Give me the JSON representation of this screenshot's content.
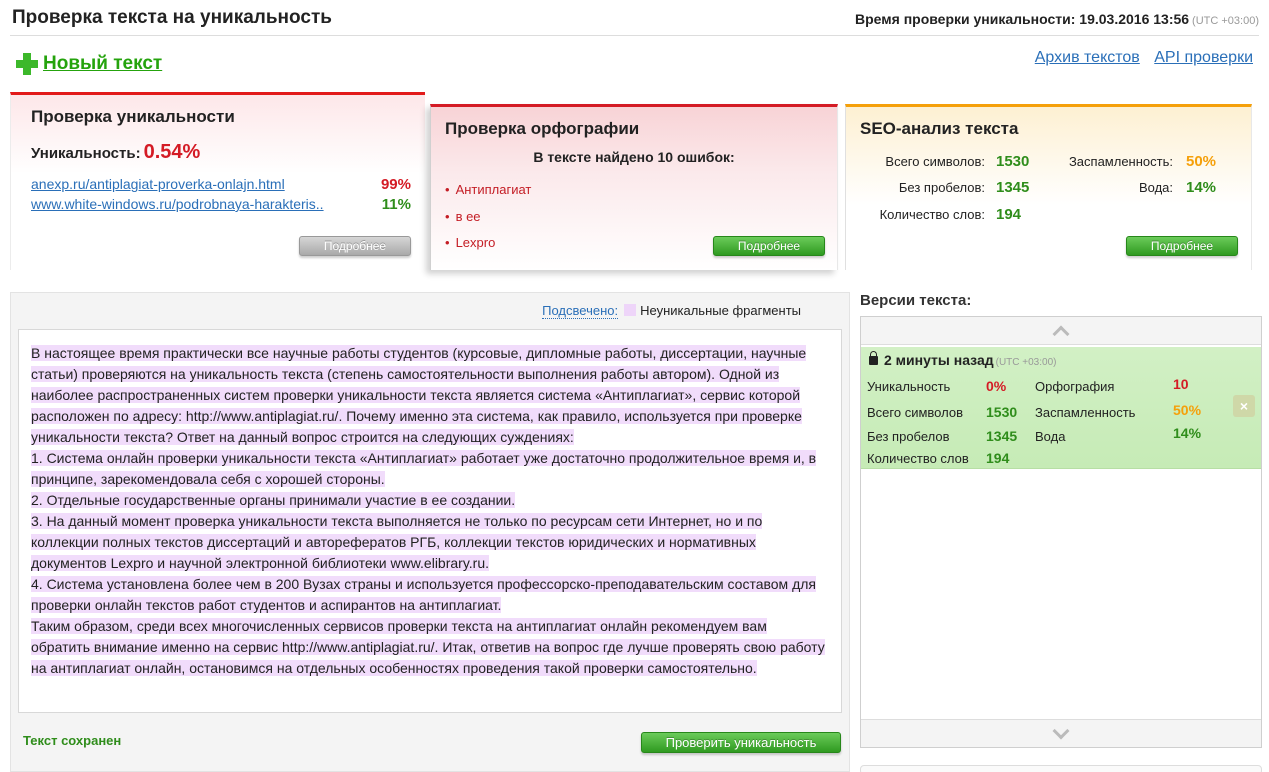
{
  "header": {
    "title": "Проверка текста на уникальность",
    "check_time_label": "Время проверки уникальности: 19.03.2016 13:56",
    "check_time_tz": "(UTC +03:00)"
  },
  "toolbar": {
    "new_text": "Новый текст",
    "links": [
      "Архив текстов",
      "API проверки"
    ]
  },
  "uniqueness_card": {
    "title": "Проверка уникальности",
    "label": "Уникальность:",
    "value": "0.54%",
    "sources": [
      {
        "url": "anexp.ru/antiplagiat-proverka-onlajn.html",
        "percent": "99%"
      },
      {
        "url": "www.white-windows.ru/podrobnaya-harakteris..",
        "percent": "11%"
      }
    ],
    "more_label": "Подробнее"
  },
  "spelling_card": {
    "title": "Проверка орфографии",
    "subtitle": "В тексте найдено 10 ошибок:",
    "errors": [
      "Антиплагиат",
      "в ее",
      "Lexpro"
    ],
    "more_label": "Подробнее"
  },
  "seo_card": {
    "title": "SEO-анализ текста",
    "chars_label": "Всего символов:",
    "chars_value": "1530",
    "nospace_label": "Без пробелов:",
    "nospace_value": "1345",
    "words_label": "Количество слов:",
    "words_value": "194",
    "spam_label": "Заспамленность:",
    "spam_value": "50%",
    "water_label": "Вода:",
    "water_value": "14%",
    "more_label": "Подробнее"
  },
  "editor": {
    "highlight_label": "Подсвечено:",
    "highlight_legend": "Неуникальные фрагменты",
    "paragraphs": [
      "В настоящее время практически все научные работы студентов (курсовые, дипломные работы, диссертации, научные статьи) проверяются на уникальность текста (степень самостоятельности выполнения работы автором). Одной из наиболее распространенных систем проверки уникальности текста является система «Антиплагиат», сервис которой расположен по адресу: http://www.antiplagiat.ru/. Почему именно эта система, как правило, используется при проверке уникальности текста? Ответ на данный вопрос строится на следующих суждениях:",
      "1. Система онлайн проверки уникальности текста «Антиплагиат» работает уже достаточно продолжительное время и, в принципе, зарекомендовала себя с хорошей стороны.",
      "2. Отдельные государственные органы принимали участие в ее создании.",
      "3. На данный момент проверка уникальности текста выполняется не только по ресурсам сети Интернет, но и по коллекции полных текстов диссертаций и авторефератов РГБ, коллекции текстов юридических и нормативных документов Lexpro и научной электронной библиотеки www.elibrary.ru.",
      "4. Система установлена более чем в 200 Вузах страны и используется профессорско-преподавательским составом для проверки онлайн текстов работ студентов и аспирантов на антиплагиат.",
      "Таким образом, среди всех многочисленных сервисов проверки текста на антиплагиат онлайн рекомендуем вам обратить внимание именно на сервис http://www.antiplagiat.ru/. Итак, ответив на вопрос где лучше проверять свою работу на антиплагиат онлайн, остановимся на отдельных особенностях проведения такой проверки самостоятельно."
    ],
    "saved_status": "Текст сохранен",
    "check_button": "Проверить уникальность"
  },
  "versions": {
    "title": "Версии текста:",
    "items": [
      {
        "time": "2 минуты назад",
        "tz": "(UTC +03:00)",
        "uniq_label": "Уникальность",
        "uniq_value": "0%",
        "spell_label": "Орфография",
        "spell_value": "10",
        "chars_label": "Всего символов",
        "chars_value": "1530",
        "spam_label": "Заспамленность",
        "spam_value": "50%",
        "nospace_label": "Без пробелов",
        "nospace_value": "1345",
        "water_label": "Вода",
        "water_value": "14%",
        "words_label": "Количество слов",
        "words_value": "194",
        "close_symbol": "×"
      }
    ]
  },
  "colors": {
    "accent_green": "#2f8d1b",
    "accent_red": "#d41b25",
    "accent_orange": "#f5a00a",
    "link": "#2a6fb8",
    "highlight": "#f1dcfb"
  }
}
